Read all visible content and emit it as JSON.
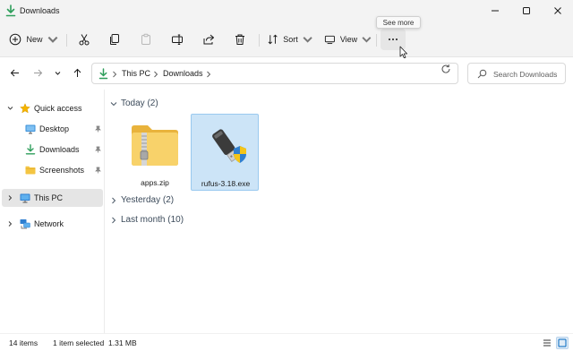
{
  "window": {
    "title": "Downloads"
  },
  "commandbar": {
    "new_label": "New",
    "sort_label": "Sort",
    "view_label": "View",
    "more_tooltip": "See more"
  },
  "address": {
    "crumbs": [
      "This PC",
      "Downloads"
    ]
  },
  "search": {
    "placeholder": "Search Downloads"
  },
  "sidebar": {
    "items": [
      {
        "label": "Quick access",
        "icon": "star-icon"
      },
      {
        "label": "Desktop",
        "icon": "desktop-icon"
      },
      {
        "label": "Downloads",
        "icon": "download-icon"
      },
      {
        "label": "Screenshots",
        "icon": "folder-icon"
      },
      {
        "label": "This PC",
        "icon": "computer-icon"
      },
      {
        "label": "Network",
        "icon": "network-icon"
      }
    ]
  },
  "groups": [
    {
      "label": "Today (2)"
    },
    {
      "label": "Yesterday (2)"
    },
    {
      "label": "Last month (10)"
    }
  ],
  "files": [
    {
      "name": "apps.zip",
      "icon": "zip-folder-icon"
    },
    {
      "name": "rufus-3.18.exe",
      "icon": "usb-drive-icon"
    }
  ],
  "status": {
    "item_count": "14 items",
    "selection": "1 item selected",
    "size": "1.31 MB"
  },
  "colors": {
    "accent": "#0067c0",
    "selection_bg": "#cce4f7",
    "selection_border": "#99c9ef",
    "download_green": "#2e9e5b",
    "folder_yellow": "#f4c542"
  }
}
